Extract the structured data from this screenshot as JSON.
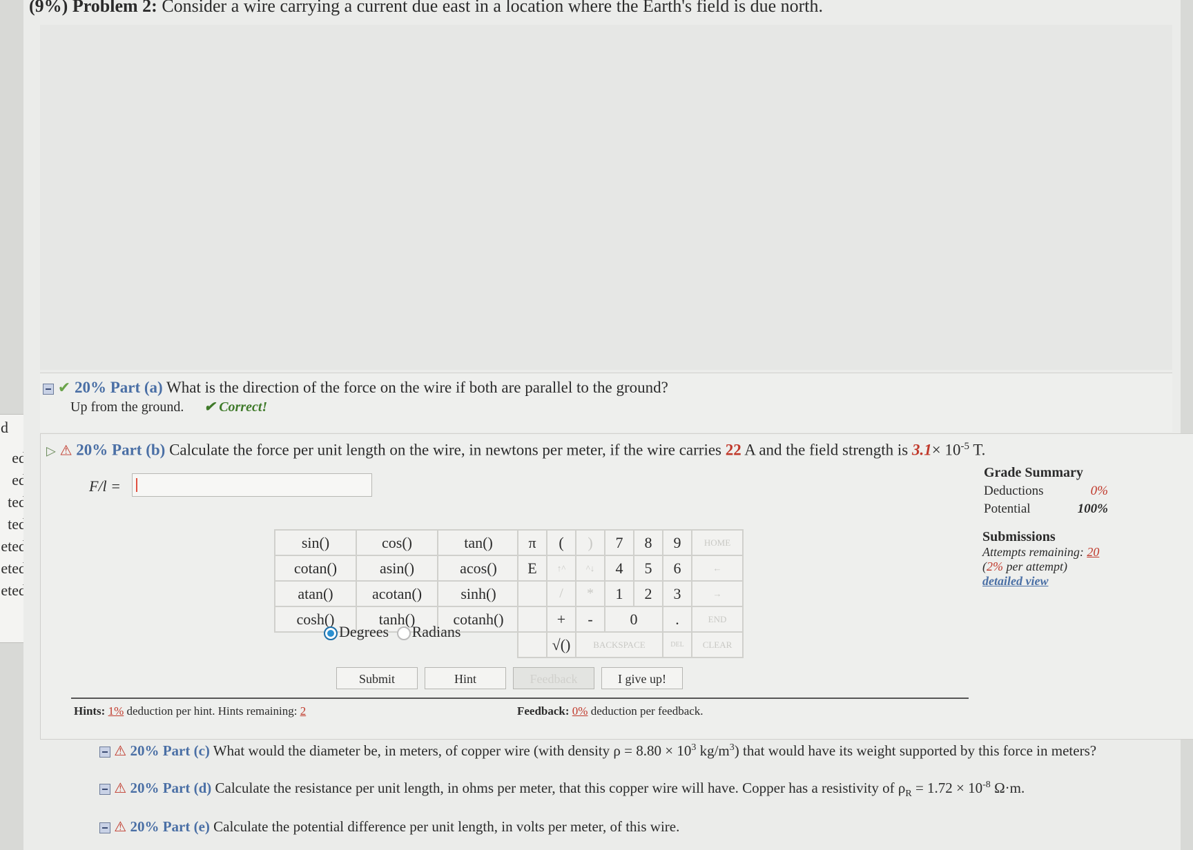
{
  "sidebar": {
    "fragments": [
      "d",
      "ed",
      "ed",
      "ted",
      "ted",
      "eted",
      "eted",
      "eted"
    ]
  },
  "problem": {
    "weight": "(9%)",
    "label": "Problem 2:",
    "text": "Consider a wire carrying a current due east in a location where the Earth's field is due north."
  },
  "part_a": {
    "percent": "20%",
    "label": "Part (a)",
    "question": "What is the direction of the force on the wire if both are parallel to the ground?",
    "answer": "Up from the ground.",
    "status": "Correct!"
  },
  "part_b": {
    "percent": "20%",
    "label": "Part (b)",
    "question_pre": "Calculate the force per unit length on the wire, in newtons per meter, if the wire carries",
    "current": "22",
    "question_mid": "A and the field strength is",
    "field": "3.1",
    "field_rest": "× 10",
    "field_exp": "-5",
    "field_unit": "T.",
    "input_label": "F/l =",
    "input_value": ""
  },
  "grade_summary": {
    "title": "Grade Summary",
    "deductions_label": "Deductions",
    "deductions_value": "0%",
    "potential_label": "Potential",
    "potential_value": "100%"
  },
  "submissions": {
    "title": "Submissions",
    "attempts_label": "Attempts remaining:",
    "attempts_value": "20",
    "per_attempt_pct": "2%",
    "per_attempt_text": "per attempt)",
    "detailed_view": "detailed view"
  },
  "calculator": {
    "functions": [
      [
        "sin()",
        "cos()",
        "tan()"
      ],
      [
        "cotan()",
        "asin()",
        "acos()"
      ],
      [
        "atan()",
        "acotan()",
        "sinh()"
      ],
      [
        "cosh()",
        "tanh()",
        "cotanh()"
      ]
    ],
    "angle_degrees": "Degrees",
    "angle_radians": "Radians",
    "keys": [
      [
        "π",
        "(",
        ")",
        "7",
        "8",
        "9",
        "HOME"
      ],
      [
        "E",
        "↑^",
        "^↓",
        "4",
        "5",
        "6",
        "←"
      ],
      [
        "",
        "/",
        "*",
        "1",
        "2",
        "3",
        "→"
      ],
      [
        "",
        "+",
        "-",
        "0",
        ".",
        "END"
      ],
      [
        "",
        "√()",
        "BACKSPACE",
        "DEL",
        "CLEAR"
      ]
    ]
  },
  "buttons": {
    "submit": "Submit",
    "hint": "Hint",
    "feedback": "Feedback",
    "give_up": "I give up!"
  },
  "hints": {
    "label": "Hints:",
    "deduction": "1%",
    "text": "deduction per hint. Hints remaining:",
    "remaining": "2"
  },
  "feedback": {
    "label": "Feedback:",
    "deduction": "0%",
    "text": "deduction per feedback."
  },
  "part_c": {
    "percent": "20%",
    "label": "Part (c)",
    "question_pre": "What would the diameter be, in meters, of copper wire (with density ρ = 8.80 × 10",
    "exp": "3",
    "question_mid": "kg/m",
    "exp2": "3",
    "question_post": ") that would have its weight supported by this force in meters?"
  },
  "part_d": {
    "percent": "20%",
    "label": "Part (d)",
    "question_pre": "Calculate the resistance per unit length, in ohms per meter, that this copper wire will have. Copper has a resistivity of ρ",
    "sub": "R",
    "question_mid": "= 1.72 × 10",
    "exp": "-8",
    "question_post": "Ω·m."
  },
  "part_e": {
    "percent": "20%",
    "label": "Part (e)",
    "question": "Calculate the potential difference per unit length, in volts per meter, of this wire."
  }
}
